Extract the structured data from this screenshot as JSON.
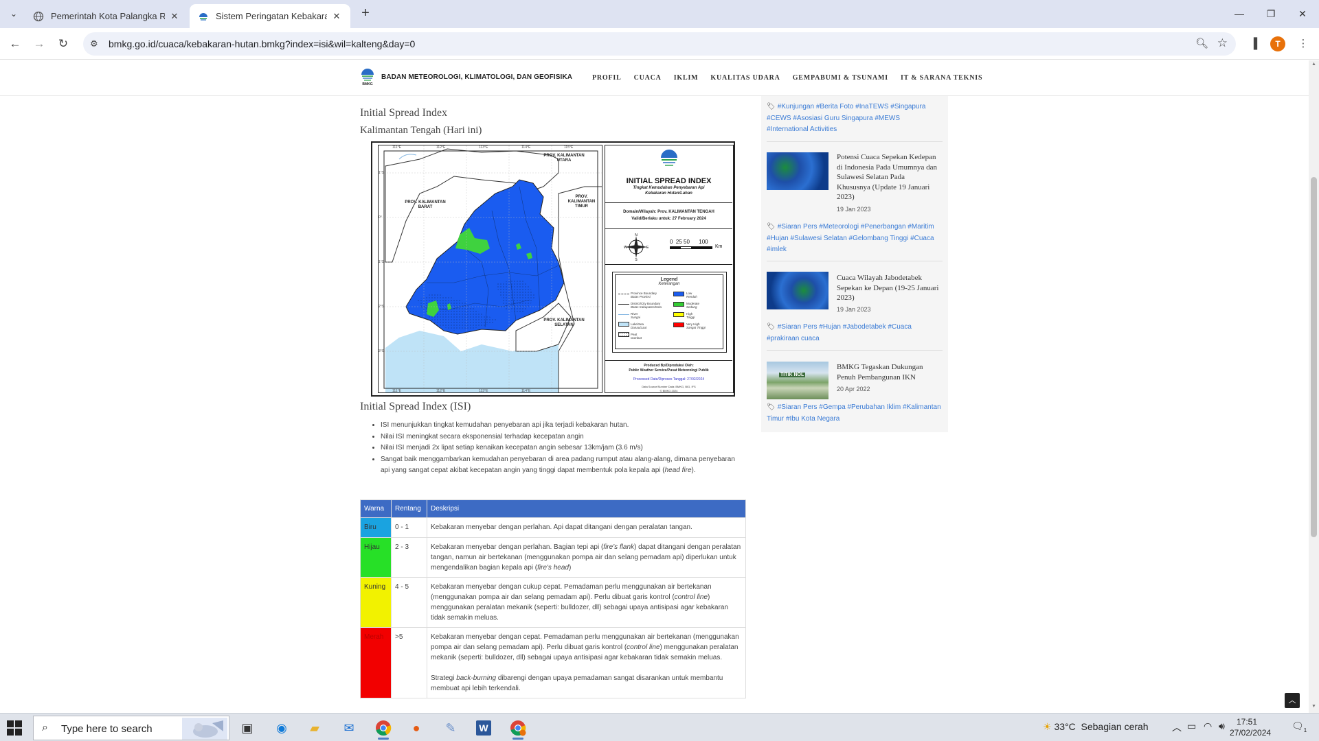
{
  "browser": {
    "tabs": [
      {
        "title": "Pemerintah Kota Palangka Raya"
      },
      {
        "title": "Sistem Peringatan Kebakaran Hutan"
      }
    ],
    "url": "bmkg.go.id/cuaca/kebakaran-hutan.bmkg?index=isi&wil=kalteng&day=0",
    "profile_initial": "T"
  },
  "site": {
    "org_name": "BADAN METEOROLOGI, KLIMATOLOGI, DAN GEOFISIKA",
    "logo_caption": "BMKG",
    "nav": [
      "PROFIL",
      "CUACA",
      "IKLIM",
      "KUALITAS UDARA",
      "GEMPABUMI & TSUNAMI",
      "IT & SARANA TEKNIS"
    ]
  },
  "content": {
    "heading": "Initial Spread Index",
    "region": "Kalimantan Tengah (Hari ini)",
    "map": {
      "title": "INITIAL SPREAD INDEX",
      "subtitle_1": "Tingkat Kemudahan Penyebaran Api",
      "subtitle_2": "Kebakaran Hutan/Lahan",
      "domain": "Domain/Wilayah: Prov. KALIMANTAN TENGAH",
      "valid": "Valid/Berlaku untuk: 27 February 2024",
      "scale_values": "0  25 50      100",
      "scale_unit": "Km",
      "legend_title": "Legend",
      "legend_subtitle": "Keterangan",
      "legend_left": [
        {
          "en": "Province Boundary",
          "id": "Batas Provinsi"
        },
        {
          "en": "District/City Boundary",
          "id": "Batas Kabupaten/Kota"
        },
        {
          "en": "River",
          "id": "Sungai"
        },
        {
          "en": "Lake/Sea",
          "id": "Danau/Laut"
        },
        {
          "en": "Peat",
          "id": "Gambut"
        }
      ],
      "legend_right": [
        {
          "en": "Low",
          "id": "Rendah",
          "color": "#1a5cf0"
        },
        {
          "en": "Moderate",
          "id": "Sedang",
          "color": "#33cc33"
        },
        {
          "en": "High",
          "id": "Tinggi",
          "color": "#ffff00"
        },
        {
          "en": "Very High",
          "id": "Sangat Tinggi",
          "color": "#ff0000"
        }
      ],
      "produced_1": "Produced By/Diproduksi Oleh:",
      "produced_2": "Public Weather Service/Pusat Meteorologi Publik",
      "processed": "Processed Date/Diproses Tanggal: 27/02/2024",
      "source": "Data Source/Sumber Data: BMKG, BIG, IFS",
      "copyright": "© BMKG 2024",
      "provinces": {
        "kalbar": "PROV. KALIMANTAN BARAT",
        "kaltim": "PROV. KALIMANTAN TIMUR",
        "kalsel": "PROV. KALIMANTAN SELATAN",
        "kaltara": "PROV. KALIMANTAN UTARA"
      },
      "lon_ticks": [
        "111°E",
        "112°E",
        "113°E",
        "114°E",
        "115°E"
      ],
      "lat_ticks": [
        "1°S",
        "0°",
        "1°S",
        "2°S",
        "3°S"
      ]
    },
    "definition_heading": "Initial Spread Index (ISI)",
    "bullets": [
      "ISI menunjukkan tingkat kemudahan penyebaran api jika terjadi kebakaran hutan.",
      "Nilai ISI meningkat secara eksponensial terhadap kecepatan angin",
      "Nilai ISI menjadi 2x lipat setiap kenaikan kecepatan angin sebesar 13km/jam (3.6 m/s)"
    ],
    "bullet4_main": "Sangat baik menggambarkan kemudahan penyebaran di area padang rumput atau alang-alang, dimana penyebaran api yang sangat cepat akibat kecepatan angin yang tinggi dapat membentuk pola kepala api (",
    "bullet4_em": "head fire",
    "bullet4_end": ").",
    "table": {
      "headers": [
        "Warna",
        "Rentang",
        "Deskripsi"
      ],
      "rows": [
        {
          "color_name": "Biru",
          "color": "#1aa3e0",
          "range": "0 - 1",
          "desc": "Kebakaran menyebar dengan perlahan. Api dapat ditangani dengan peralatan tangan."
        },
        {
          "color_name": "Hijau",
          "color": "#27e027",
          "range": "2 - 3",
          "desc_a": "Kebakaran menyebar dengan perlahan. Bagian tepi api (",
          "desc_em1": "fire's flank",
          "desc_b": ") dapat ditangani dengan peralatan tangan, namun air bertekanan (menggunakan pompa air dan selang pemadam api) diperlukan untuk mengendalikan bagian kepala api (",
          "desc_em2": "fire's head",
          "desc_c": ")"
        },
        {
          "color_name": "Kuning",
          "color": "#f2f200",
          "range": "4 - 5",
          "desc_a": "Kebakaran menyebar dengan cukup cepat. Pemadaman perlu menggunakan air bertekanan (menggunakan pompa air dan selang pemadam api). Perlu dibuat garis kontrol (",
          "desc_em1": "control line",
          "desc_b": ") menggunakan peralatan mekanik (seperti: bulldozer, dll) sebagai upaya antisipasi agar kebakaran tidak semakin meluas."
        },
        {
          "color_name": "Merah",
          "color": "#f20000",
          "range": ">5",
          "desc_a": "Kebakaran menyebar dengan cepat. Pemadaman perlu menggunakan air bertekanan (menggunakan pompa air dan selang pemadam api). Perlu dibuat garis kontrol (",
          "desc_em1": "control line",
          "desc_b": ") menggunakan peralatan mekanik (seperti: bulldozer, dll) sebagai upaya antisipasi agar kebakaran tidak semakin meluas.",
          "desc2_a": "Strategi ",
          "desc2_em": "back-burning",
          "desc2_b": " dibarengi dengan upaya pemadaman sangat disarankan untuk membantu membuat api lebih terkendali."
        }
      ]
    }
  },
  "sidebar": {
    "tag_groups": [
      [
        "#Kunjungan",
        "#Berita Foto",
        "#InaTEWS",
        "#Singapura",
        "#CEWS",
        "#Asosiasi Guru Singapura",
        "#MEWS",
        "#International Activities"
      ],
      [
        "#Siaran Pers",
        "#Meteorologi",
        "#Penerbangan",
        "#Maritim",
        "#Hujan",
        "#Sulawesi Selatan",
        "#Gelombang Tinggi",
        "#Cuaca",
        "#imlek"
      ],
      [
        "#Siaran Pers",
        "#Hujan",
        "#Jabodetabek",
        "#Cuaca",
        "#prakiraan cuaca"
      ],
      [
        "#Siaran Pers",
        "#Gempa",
        "#Perubahan Iklim",
        "#Kalimantan Timur",
        "#Ibu Kota Negara"
      ]
    ],
    "news": [
      {
        "title": "Potensi Cuaca Sepekan Kedepan di Indonesia Pada Umumnya dan Sulawesi Selatan Pada Khususnya (Update 19 Januari 2023)",
        "date": "19 Jan 2023"
      },
      {
        "title": "Cuaca Wilayah Jabodetabek Sepekan ke Depan (19-25 Januari 2023)",
        "date": "19 Jan 2023"
      },
      {
        "title": "BMKG Tegaskan Dukungan Penuh Pembangunan IKN",
        "date": "20 Apr 2022"
      }
    ],
    "ikn_banner": "TITIK NOL"
  },
  "taskbar": {
    "search_placeholder": "Type here to search",
    "weather_temp": "33°C",
    "weather_desc": "Sebagian cerah",
    "time": "17:51",
    "date": "27/02/2024",
    "notification_count": "1"
  }
}
